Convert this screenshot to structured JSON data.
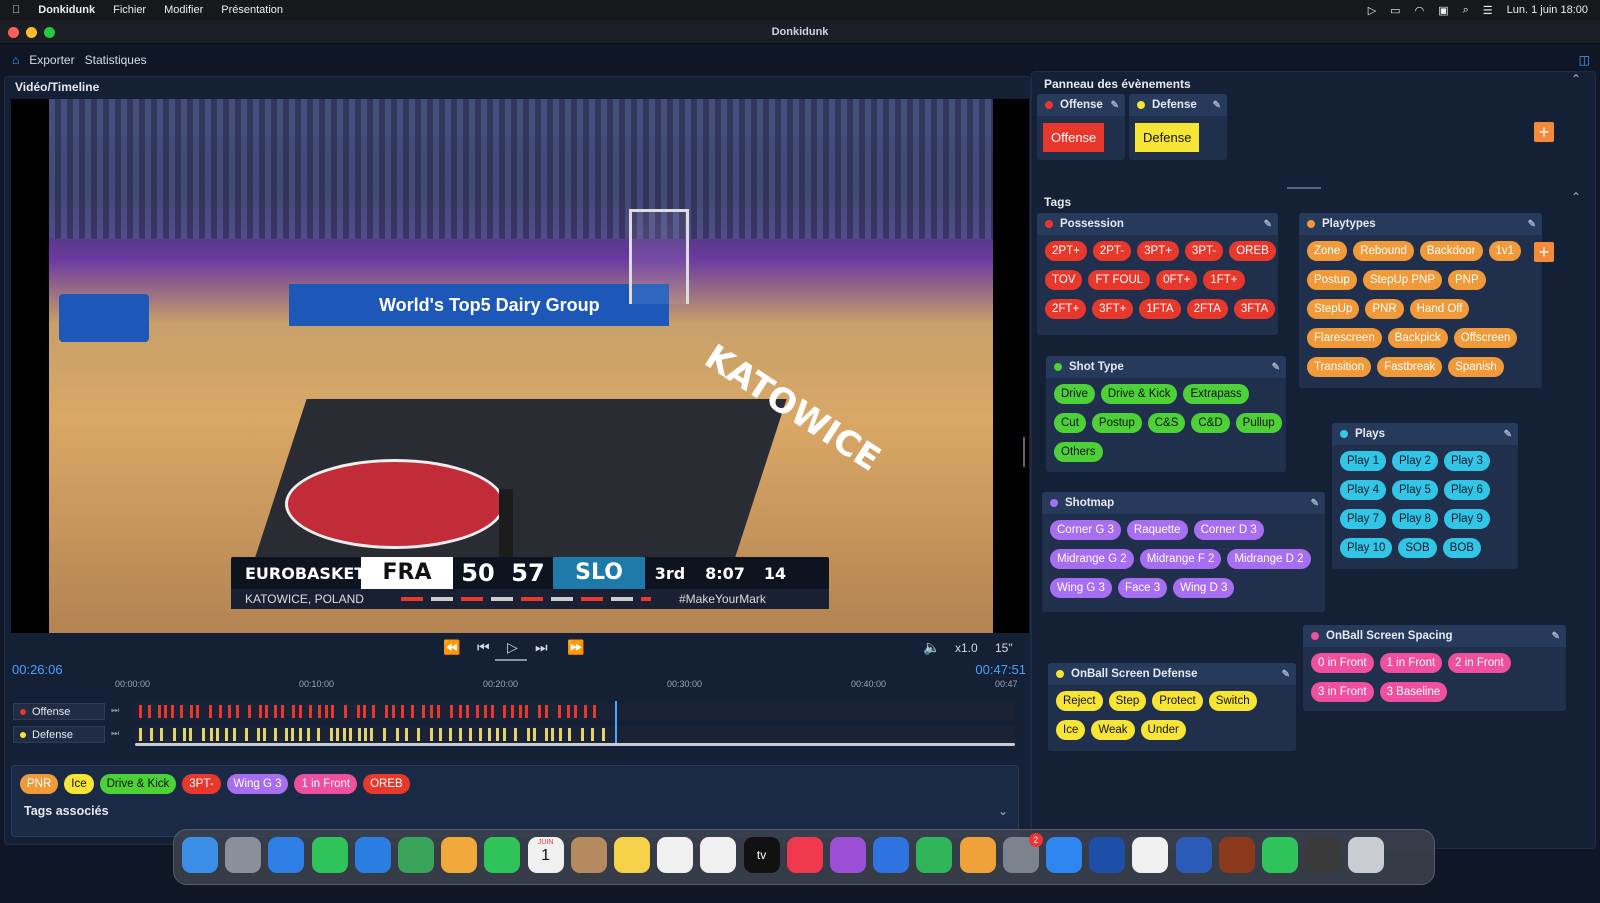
{
  "menubar": {
    "apple": "",
    "app": "Donkidunk",
    "items": [
      "Fichier",
      "Modifier",
      "Présentation"
    ],
    "clock": "Lun. 1 juin  18:00"
  },
  "window": {
    "title": "Donkidunk"
  },
  "toolbar": {
    "export": "Exporter",
    "stats": "Statistiques"
  },
  "video_panel": {
    "title": "Vidéo/Timeline"
  },
  "scoreboard": {
    "brand": "EUROBASKET",
    "team1": "FRA",
    "score1": "50",
    "score2": "57",
    "team2": "SLO",
    "period": "3rd",
    "clock": "8:07",
    "shot_clock": "14",
    "location": "KATOWICE, POLAND",
    "hashtag": "#MakeYourMark"
  },
  "court_text": {
    "banner": "World's Top5 Dairy Group",
    "floor": "KATOWICE"
  },
  "controls": {
    "speed": "x1.0",
    "skip": "15\""
  },
  "timeline": {
    "current": "00:26:06",
    "total": "00:47:51",
    "ticks": [
      "00:00:00",
      "00:10:00",
      "00:20:00",
      "00:30:00",
      "00:40:00",
      "00:47"
    ],
    "tracks": [
      {
        "name": "Offense",
        "color": "#e8382c"
      },
      {
        "name": "Defense",
        "color": "#f6e534"
      }
    ]
  },
  "associated": {
    "title": "Tags associés",
    "tags": [
      {
        "label": "PNR",
        "c": "orange"
      },
      {
        "label": "Ice",
        "c": "yellow"
      },
      {
        "label": "Drive & Kick",
        "c": "green"
      },
      {
        "label": "3PT-",
        "c": "red"
      },
      {
        "label": "Wing G 3",
        "c": "purple"
      },
      {
        "label": "1 in Front",
        "c": "pink"
      },
      {
        "label": "OREB",
        "c": "red"
      }
    ]
  },
  "events": {
    "title": "Panneau des évènements",
    "offense_header": "Offense",
    "offense_btn": "Offense",
    "defense_header": "Defense",
    "defense_btn": "Defense"
  },
  "tags_panel": {
    "title": "Tags"
  },
  "possession": {
    "title": "Possession",
    "rows": [
      [
        "2PT+",
        "2PT-",
        "3PT+",
        "3PT-",
        "OREB"
      ],
      [
        "TOV",
        "FT FOUL",
        "0FT+",
        "1FT+"
      ],
      [
        "2FT+",
        "3FT+",
        "1FTA",
        "2FTA",
        "3FTA"
      ]
    ]
  },
  "playtypes": {
    "title": "Playtypes",
    "rows": [
      [
        "Zone",
        "Rebound",
        "Backdoor",
        "1v1"
      ],
      [
        "Postup",
        "StepUp PNP",
        "PNP"
      ],
      [
        "StepUp",
        "PNR",
        "Hand Off"
      ],
      [
        "Flarescreen",
        "Backpick",
        "Offscreen"
      ],
      [
        "Transition",
        "Fastbreak",
        "Spanish"
      ]
    ]
  },
  "shottype": {
    "title": "Shot Type",
    "rows": [
      [
        "Drive",
        "Drive & Kick",
        "Extrapass"
      ],
      [
        "Cut",
        "Postup",
        "C&S",
        "C&D",
        "Pullup"
      ],
      [
        "Others"
      ]
    ]
  },
  "plays": {
    "title": "Plays",
    "rows": [
      [
        "Play 1",
        "Play 2",
        "Play 3"
      ],
      [
        "Play 4",
        "Play 5",
        "Play 6"
      ],
      [
        "Play 7",
        "Play 8",
        "Play 9"
      ],
      [
        "Play 10",
        "SOB",
        "BOB"
      ]
    ]
  },
  "shotmap": {
    "title": "Shotmap",
    "rows": [
      [
        "Corner G 3",
        "Raquette",
        "Corner D 3"
      ],
      [
        "Midrange G 2",
        "Midrange F 2",
        "Midrange D 2"
      ],
      [
        "Wing G 3",
        "Face 3",
        "Wing D 3"
      ]
    ]
  },
  "spacing": {
    "title": "OnBall Screen Spacing",
    "rows": [
      [
        "0 in Front",
        "1 in Front",
        "2 in Front"
      ],
      [
        "3 in Front",
        "3 Baseline"
      ]
    ]
  },
  "screendef": {
    "title": "OnBall Screen Defense",
    "rows": [
      [
        "Reject",
        "Step",
        "Protect",
        "Switch"
      ],
      [
        "Ice",
        "Weak",
        "Under"
      ]
    ]
  },
  "colors": {
    "accent": "#f58a3a",
    "offense": "#e8382c",
    "defense": "#f6e534",
    "timecode": "#4aa3ff"
  },
  "dock": {
    "items": [
      "finder-icon",
      "launchpad-icon",
      "safari-icon",
      "messages-icon",
      "mail-icon",
      "maps-icon",
      "photos-icon",
      "facetime-icon",
      "calendar-icon",
      "contacts-icon",
      "notes-icon",
      "freeform-icon",
      "reminders-icon",
      "tv-icon",
      "music-icon",
      "podcasts-icon",
      "keynote-icon",
      "numbers-icon",
      "pages-icon",
      "settings-icon",
      "appstore-icon",
      "donkidunk-icon",
      "chrome-icon",
      "word-icon",
      "game-icon",
      "whatsapp-icon",
      "preview-icon",
      "trash-icon"
    ],
    "calendar_day": "1",
    "calendar_month": "JUIN",
    "settings_badge": "2",
    "tv_label": "tv"
  }
}
